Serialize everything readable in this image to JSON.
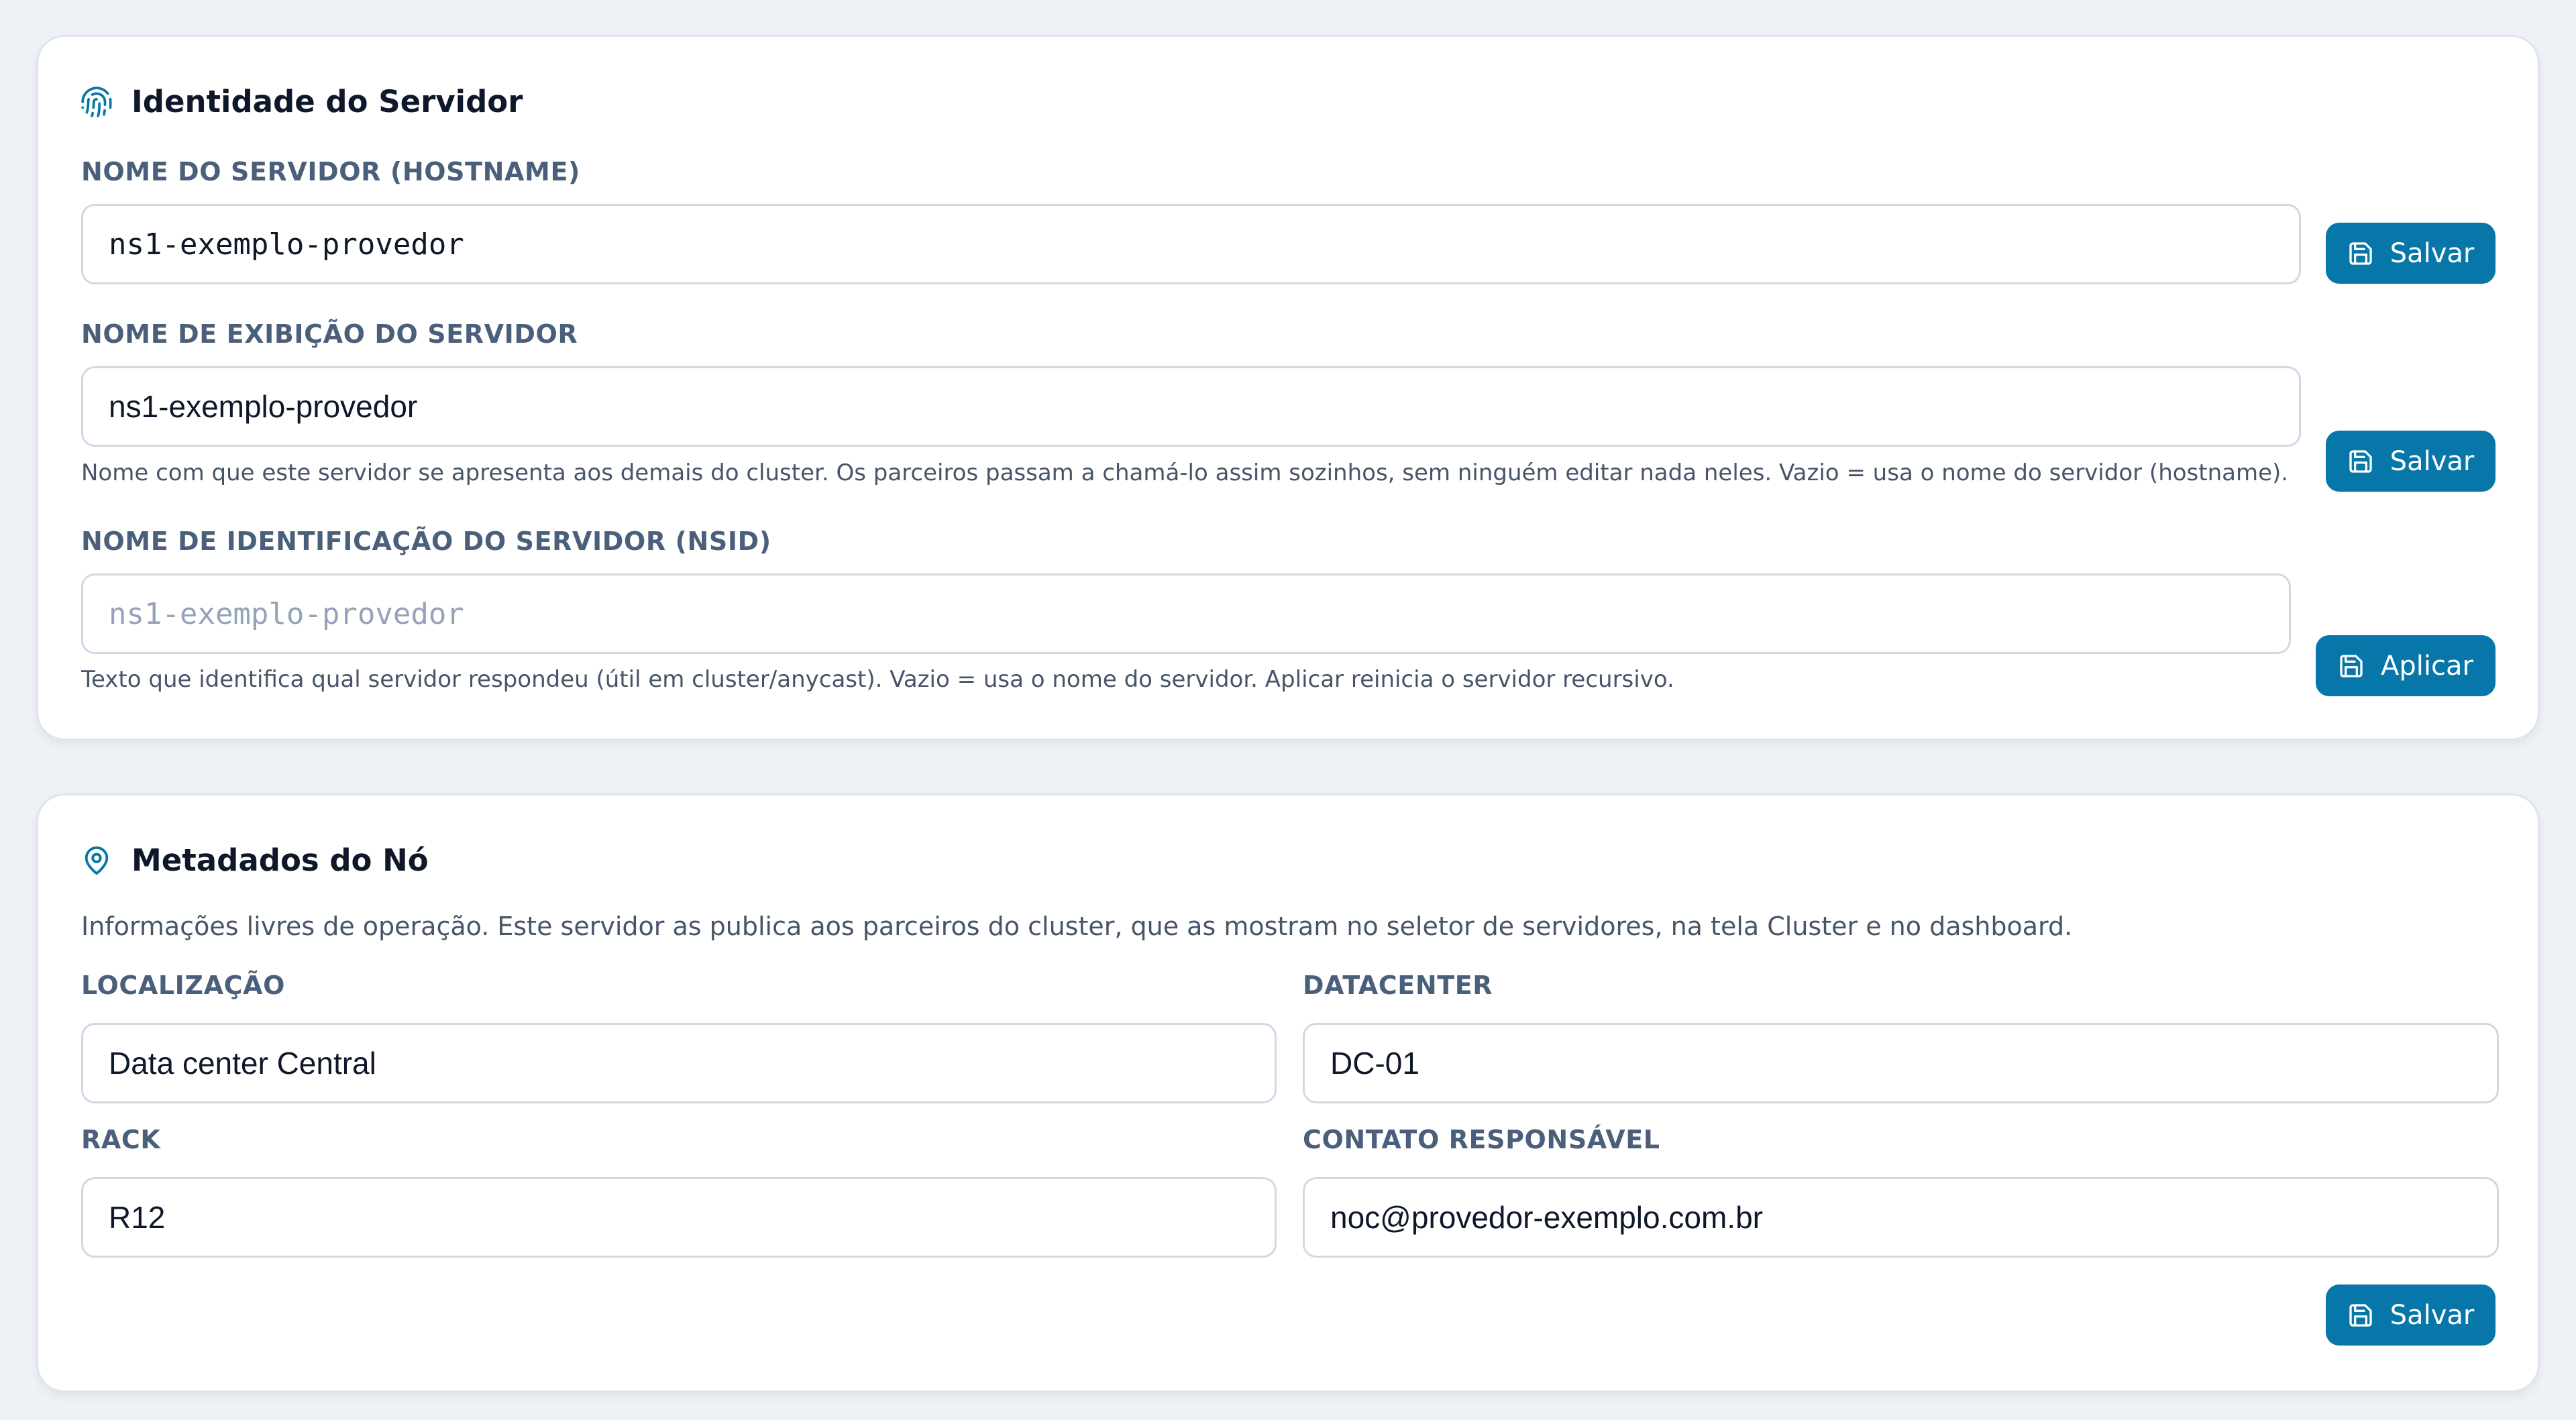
{
  "identity": {
    "title": "Identidade do Servidor",
    "icon": "fingerprint-icon",
    "hostname": {
      "label": "NOME DO SERVIDOR (HOSTNAME)",
      "value": "ns1-exemplo-provedor",
      "button": "Salvar"
    },
    "display_name": {
      "label": "NOME DE EXIBIÇÃO DO SERVIDOR",
      "value": "ns1-exemplo-provedor",
      "help": "Nome com que este servidor se apresenta aos demais do cluster. Os parceiros passam a chamá-lo assim sozinhos, sem ninguém editar nada neles. Vazio = usa o nome do servidor (hostname).",
      "button": "Salvar"
    },
    "nsid": {
      "label": "NOME DE IDENTIFICAÇÃO DO SERVIDOR (NSID)",
      "value": "",
      "placeholder": "ns1-exemplo-provedor",
      "help": "Texto que identifica qual servidor respondeu (útil em cluster/anycast). Vazio = usa o nome do servidor. Aplicar reinicia o servidor recursivo.",
      "button": "Aplicar"
    }
  },
  "metadata": {
    "title": "Metadados do Nó",
    "icon": "map-pin-icon",
    "description": "Informações livres de operação. Este servidor as publica aos parceiros do cluster, que as mostram no seletor de servidores, na tela Cluster e no dashboard.",
    "location": {
      "label": "LOCALIZAÇÃO",
      "value": "Data center Central"
    },
    "datacenter": {
      "label": "DATACENTER",
      "value": "DC-01"
    },
    "rack": {
      "label": "RACK",
      "value": "R12"
    },
    "contact": {
      "label": "CONTATO RESPONSÁVEL",
      "value": "noc@provedor-exemplo.com.br"
    },
    "button": "Salvar"
  },
  "colors": {
    "accent": "#0677a8",
    "label": "#4a5f7a",
    "page_background": "#eef2f6",
    "card_background": "#ffffff",
    "field_border": "#cfd9e4"
  }
}
